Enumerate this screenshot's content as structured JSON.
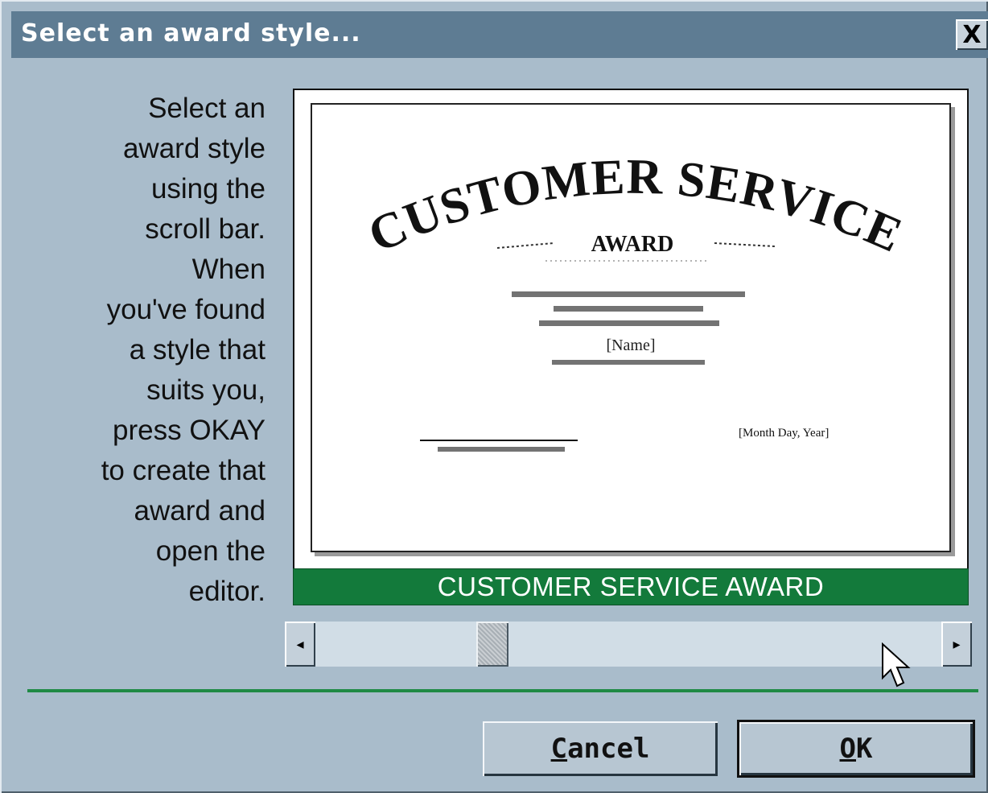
{
  "dialog": {
    "title": "Select an award style...",
    "close_label": "X"
  },
  "instructions": {
    "text": "Select an\naward style\nusing the\nscroll bar.\nWhen\nyou've found\na style that\nsuits you,\npress OKAY\nto create that\naward and\nopen the\neditor."
  },
  "preview": {
    "certificate": {
      "title_main": "CUSTOMER SERVICE",
      "title_sub": "AWARD",
      "name_placeholder": "[Name]",
      "date_placeholder": "[Month Day, Year]"
    },
    "style_name": "CUSTOMER SERVICE AWARD"
  },
  "scrollbar": {
    "left_arrow": "◂",
    "right_arrow": "▸"
  },
  "buttons": {
    "cancel_first": "C",
    "cancel_rest": "ancel",
    "ok_first": "O",
    "ok_rest": "K"
  },
  "colors": {
    "title_bar": "#5e7c93",
    "dialog_bg": "#a9bccb",
    "style_bar": "#137a3b",
    "divider": "#1f8a45"
  }
}
